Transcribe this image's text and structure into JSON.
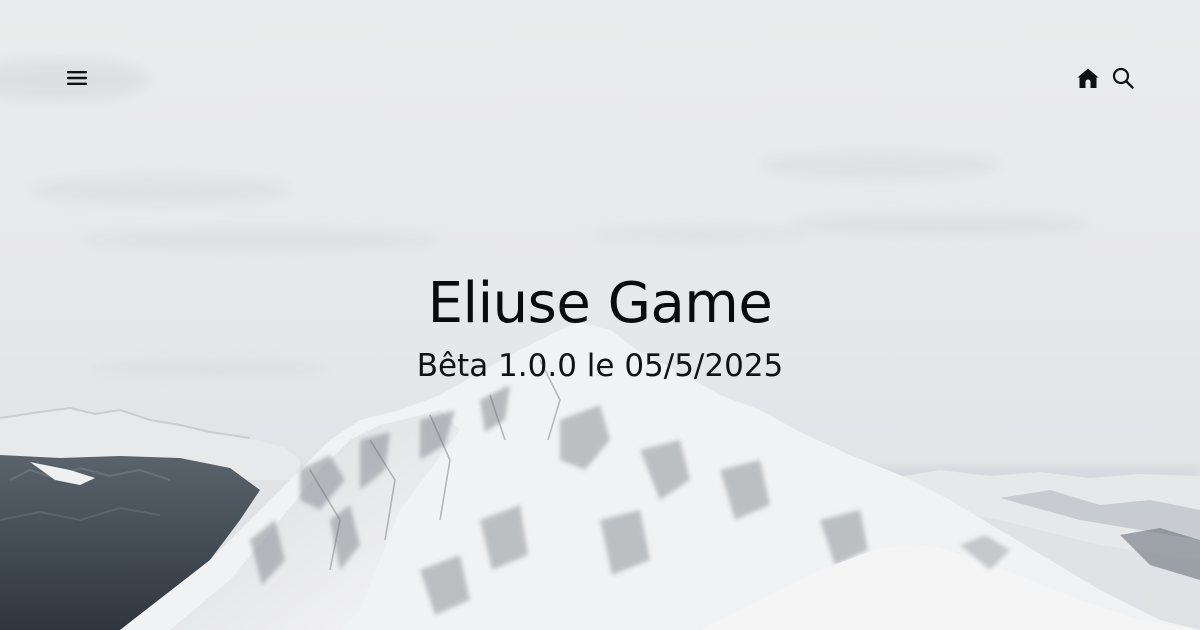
{
  "header": {
    "menu_icon": "hamburger-menu-icon",
    "home_icon": "home-icon",
    "search_icon": "search-icon"
  },
  "hero": {
    "title": "Eliuse Game",
    "subtitle": "Bêta 1.0.0 le 05/5/2025",
    "background": "snowy-mountain-photo"
  },
  "colors": {
    "sky": "#e9eaec",
    "snow": "#f4f4f5",
    "rock": "#6f7074",
    "forest": "#3a4148",
    "text": "#0b0b0b"
  }
}
